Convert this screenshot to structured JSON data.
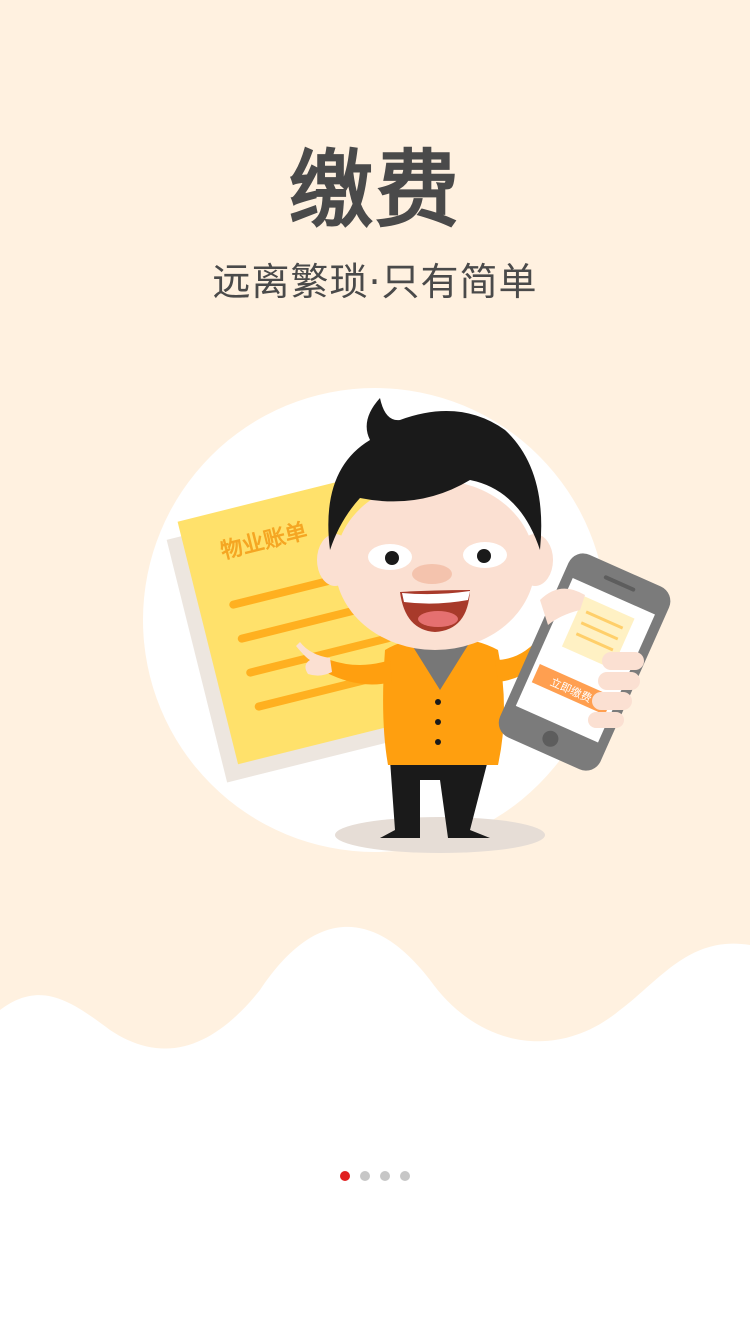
{
  "title": "缴费",
  "subtitle": "远离繁琐·只有简单",
  "illustration": {
    "bill_text": "物业账单",
    "phone_button": "立即缴费"
  },
  "pager": {
    "total": 4,
    "active_index": 0
  },
  "colors": {
    "background_top": "#fff1e0",
    "accent": "#ff9f0f",
    "active_dot": "#e02020",
    "inactive_dot": "#c7c7c7"
  }
}
